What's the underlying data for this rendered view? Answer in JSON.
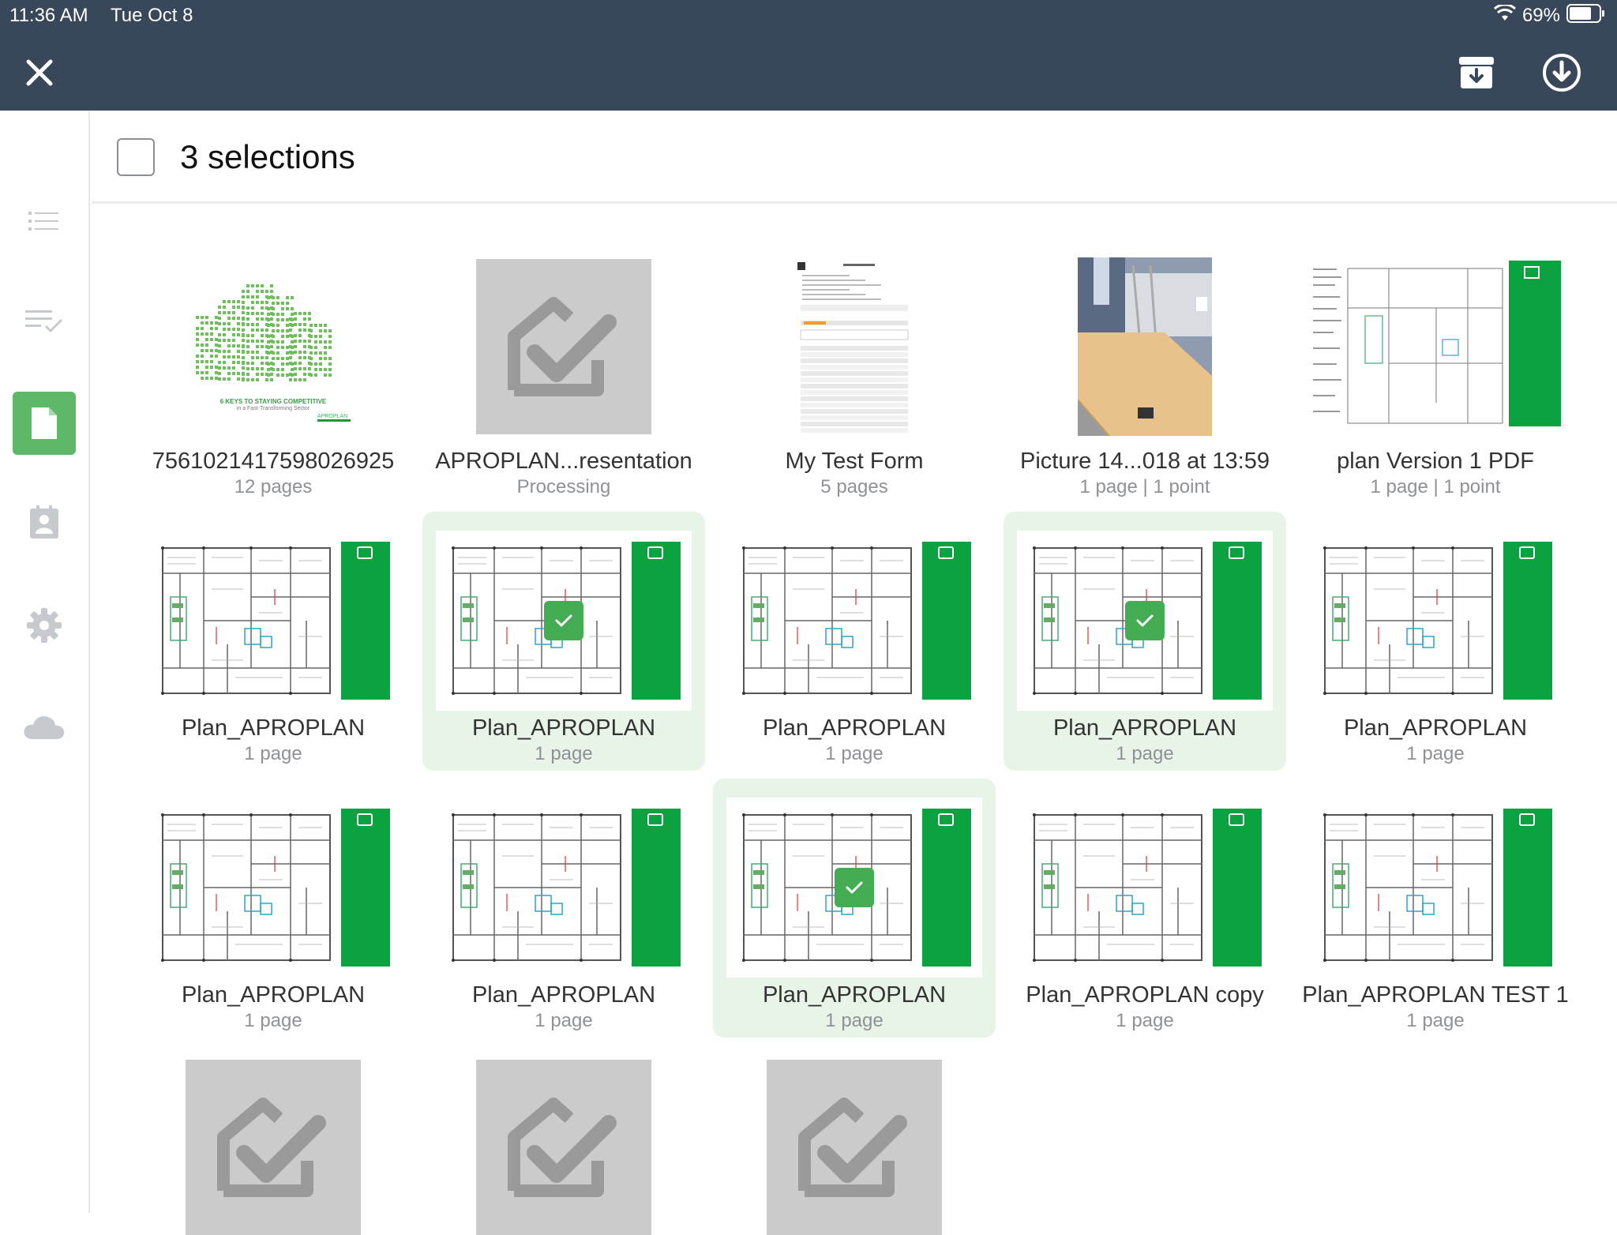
{
  "status": {
    "time": "11:36 AM",
    "date": "Tue Oct 8",
    "battery": "69%"
  },
  "header": {
    "title": "3 selections"
  },
  "sidebar": {
    "items": [
      {
        "icon": "list-icon",
        "active": false
      },
      {
        "icon": "checklist-icon",
        "active": false
      },
      {
        "icon": "document-icon",
        "active": true
      },
      {
        "icon": "contacts-icon",
        "active": false
      },
      {
        "icon": "settings-gear-icon",
        "active": false
      },
      {
        "icon": "cloud-icon",
        "active": false
      }
    ]
  },
  "colors": {
    "topbar": "#38475a",
    "accent_green": "#44ac53",
    "brand_green": "#0aa13f",
    "selected_bg": "#e8f4e8"
  },
  "tiles": [
    {
      "name": "7561021417598026925",
      "sub": "12 pages",
      "thumb": "doc-cover",
      "selected": false,
      "cover_title": "6 KEYS TO STAYING COMPETITIVE",
      "cover_subtitle": "in a Fast-Transforming Sector",
      "cover_brand": "APROPLAN"
    },
    {
      "name": "APROPLAN...resentation",
      "sub": "Processing",
      "thumb": "placeholder",
      "selected": false
    },
    {
      "name": "My Test Form",
      "sub": "5 pages",
      "thumb": "form",
      "selected": false
    },
    {
      "name": "Picture 14...018 at 13:59",
      "sub": "1 page | 1 point",
      "thumb": "photo",
      "selected": false
    },
    {
      "name": "plan Version 1 PDF",
      "sub": "1 page | 1 point",
      "thumb": "plan-wide",
      "selected": false
    },
    {
      "name": "Plan_APROPLAN",
      "sub": "1 page",
      "thumb": "plan",
      "selected": false
    },
    {
      "name": "Plan_APROPLAN",
      "sub": "1 page",
      "thumb": "plan",
      "selected": true
    },
    {
      "name": "Plan_APROPLAN",
      "sub": "1 page",
      "thumb": "plan",
      "selected": false
    },
    {
      "name": "Plan_APROPLAN",
      "sub": "1 page",
      "thumb": "plan",
      "selected": true
    },
    {
      "name": "Plan_APROPLAN",
      "sub": "1 page",
      "thumb": "plan",
      "selected": false
    },
    {
      "name": "Plan_APROPLAN",
      "sub": "1 page",
      "thumb": "plan",
      "selected": false
    },
    {
      "name": "Plan_APROPLAN",
      "sub": "1 page",
      "thumb": "plan",
      "selected": false
    },
    {
      "name": "Plan_APROPLAN",
      "sub": "1 page",
      "thumb": "plan",
      "selected": true
    },
    {
      "name": "Plan_APROPLAN copy",
      "sub": "1 page",
      "thumb": "plan",
      "selected": false
    },
    {
      "name": "Plan_APROPLAN TEST 1",
      "sub": "1 page",
      "thumb": "plan",
      "selected": false
    },
    {
      "name": "",
      "sub": "",
      "thumb": "placeholder",
      "selected": false
    },
    {
      "name": "",
      "sub": "",
      "thumb": "placeholder",
      "selected": false
    },
    {
      "name": "",
      "sub": "",
      "thumb": "placeholder",
      "selected": false
    }
  ]
}
